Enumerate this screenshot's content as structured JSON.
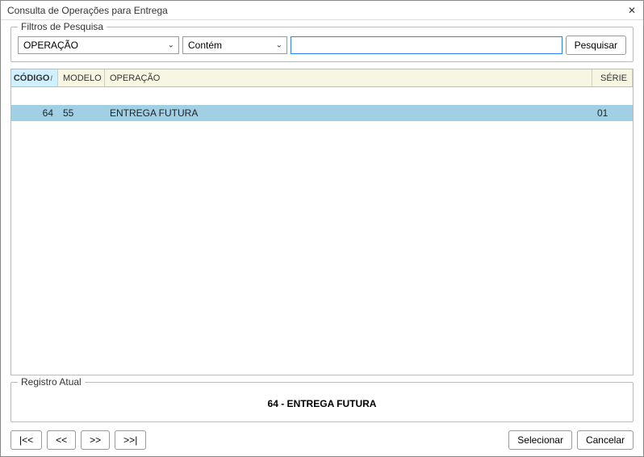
{
  "window": {
    "title": "Consulta de Operações para Entrega"
  },
  "filters": {
    "legend": "Filtros de Pesquisa",
    "field_select": "OPERAÇÃO",
    "condition_select": "Contém",
    "search_value": "",
    "search_button": "Pesquisar"
  },
  "grid": {
    "columns": {
      "codigo": "CÓDIGO",
      "modelo": "MODELO",
      "operacao": "OPERAÇÃO",
      "serie": "SÉRIE"
    },
    "row": {
      "codigo": "64",
      "modelo": "55",
      "operacao": "ENTREGA FUTURA",
      "serie": "01"
    }
  },
  "current_record": {
    "legend": "Registro Atual",
    "text": "64 - ENTREGA FUTURA"
  },
  "nav": {
    "first": "|<<",
    "prev": "<<",
    "next": ">>",
    "last": ">>|"
  },
  "actions": {
    "select": "Selecionar",
    "cancel": "Cancelar"
  }
}
